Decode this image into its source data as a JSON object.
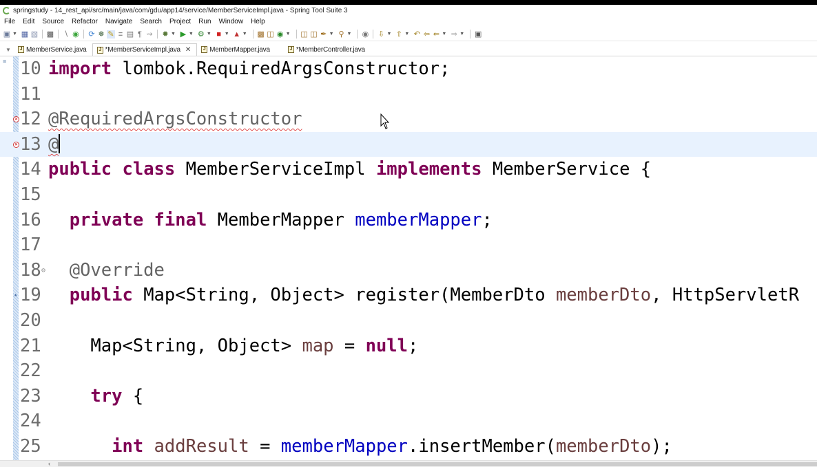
{
  "window": {
    "title": "springstudy - 14_rest_api/src/main/java/com/gdu/app14/service/MemberServiceImpl.java - Spring Tool Suite 3"
  },
  "menu": [
    "File",
    "Edit",
    "Source",
    "Refactor",
    "Navigate",
    "Search",
    "Project",
    "Run",
    "Window",
    "Help"
  ],
  "tabs": [
    {
      "label": "MemberService.java",
      "active": false,
      "closable": false
    },
    {
      "label": "*MemberServiceImpl.java",
      "active": true,
      "closable": true
    },
    {
      "label": "MemberMapper.java",
      "active": false,
      "closable": false
    },
    {
      "label": "*MemberController.java",
      "active": false,
      "closable": false
    }
  ],
  "editor": {
    "current_line": 13,
    "lines": [
      {
        "n": "10",
        "tokens": [
          [
            "kw",
            "import"
          ],
          [
            "p",
            " lombok.RequiredArgsConstructor;"
          ]
        ]
      },
      {
        "n": "11",
        "tokens": []
      },
      {
        "n": "12",
        "tokens": [
          [
            "ann-sq",
            "@RequiredArgsConstructor"
          ]
        ],
        "error": true
      },
      {
        "n": "13",
        "tokens": [
          [
            "ann-sq",
            "@"
          ]
        ],
        "error": true,
        "caret": true
      },
      {
        "n": "14",
        "tokens": [
          [
            "kw",
            "public"
          ],
          [
            "p",
            " "
          ],
          [
            "kw",
            "class"
          ],
          [
            "p",
            " MemberServiceImpl "
          ],
          [
            "kw",
            "implements"
          ],
          [
            "p",
            " MemberService {"
          ]
        ]
      },
      {
        "n": "15",
        "tokens": []
      },
      {
        "n": "16",
        "tokens": [
          [
            "p",
            "  "
          ],
          [
            "kw",
            "private"
          ],
          [
            "p",
            " "
          ],
          [
            "kw",
            "final"
          ],
          [
            "p",
            " MemberMapper "
          ],
          [
            "fld",
            "memberMapper"
          ],
          [
            "p",
            ";"
          ]
        ]
      },
      {
        "n": "17",
        "tokens": []
      },
      {
        "n": "18",
        "tokens": [
          [
            "p",
            "  "
          ],
          [
            "ann",
            "@Override"
          ]
        ],
        "fold": true
      },
      {
        "n": "19",
        "tokens": [
          [
            "p",
            "  "
          ],
          [
            "kw",
            "public"
          ],
          [
            "p",
            " Map<String, Object> register(MemberDto "
          ],
          [
            "var",
            "memberDto"
          ],
          [
            "p",
            ", HttpServletR"
          ]
        ],
        "marker": true
      },
      {
        "n": "20",
        "tokens": []
      },
      {
        "n": "21",
        "tokens": [
          [
            "p",
            "    Map<String, Object> "
          ],
          [
            "var",
            "map"
          ],
          [
            "p",
            " = "
          ],
          [
            "kw",
            "null"
          ],
          [
            "p",
            ";"
          ]
        ]
      },
      {
        "n": "22",
        "tokens": []
      },
      {
        "n": "23",
        "tokens": [
          [
            "p",
            "    "
          ],
          [
            "kw",
            "try"
          ],
          [
            "p",
            " {"
          ]
        ]
      },
      {
        "n": "24",
        "tokens": []
      },
      {
        "n": "25",
        "tokens": [
          [
            "p",
            "      "
          ],
          [
            "kw",
            "int"
          ],
          [
            "p",
            " "
          ],
          [
            "var",
            "addResult"
          ],
          [
            "p",
            " = "
          ],
          [
            "fld",
            "memberMapper"
          ],
          [
            "p",
            ".insertMember("
          ],
          [
            "var",
            "memberDto"
          ],
          [
            "p",
            ");"
          ]
        ]
      }
    ]
  },
  "colors": {
    "keyword": "#7f0055",
    "annotation": "#646464",
    "field": "#0000c0",
    "local_variable": "#6a3e3e",
    "current_line_bg": "#e8f2fe",
    "error": "#d23b3b"
  },
  "icons": [
    "new-icon",
    "save-icon",
    "save-all-icon",
    "print-icon",
    "debug-icon",
    "run-icon",
    "external-tools-icon",
    "stop-icon",
    "open-type-icon",
    "search-icon",
    "back-icon",
    "forward-icon",
    "new-window-icon"
  ]
}
